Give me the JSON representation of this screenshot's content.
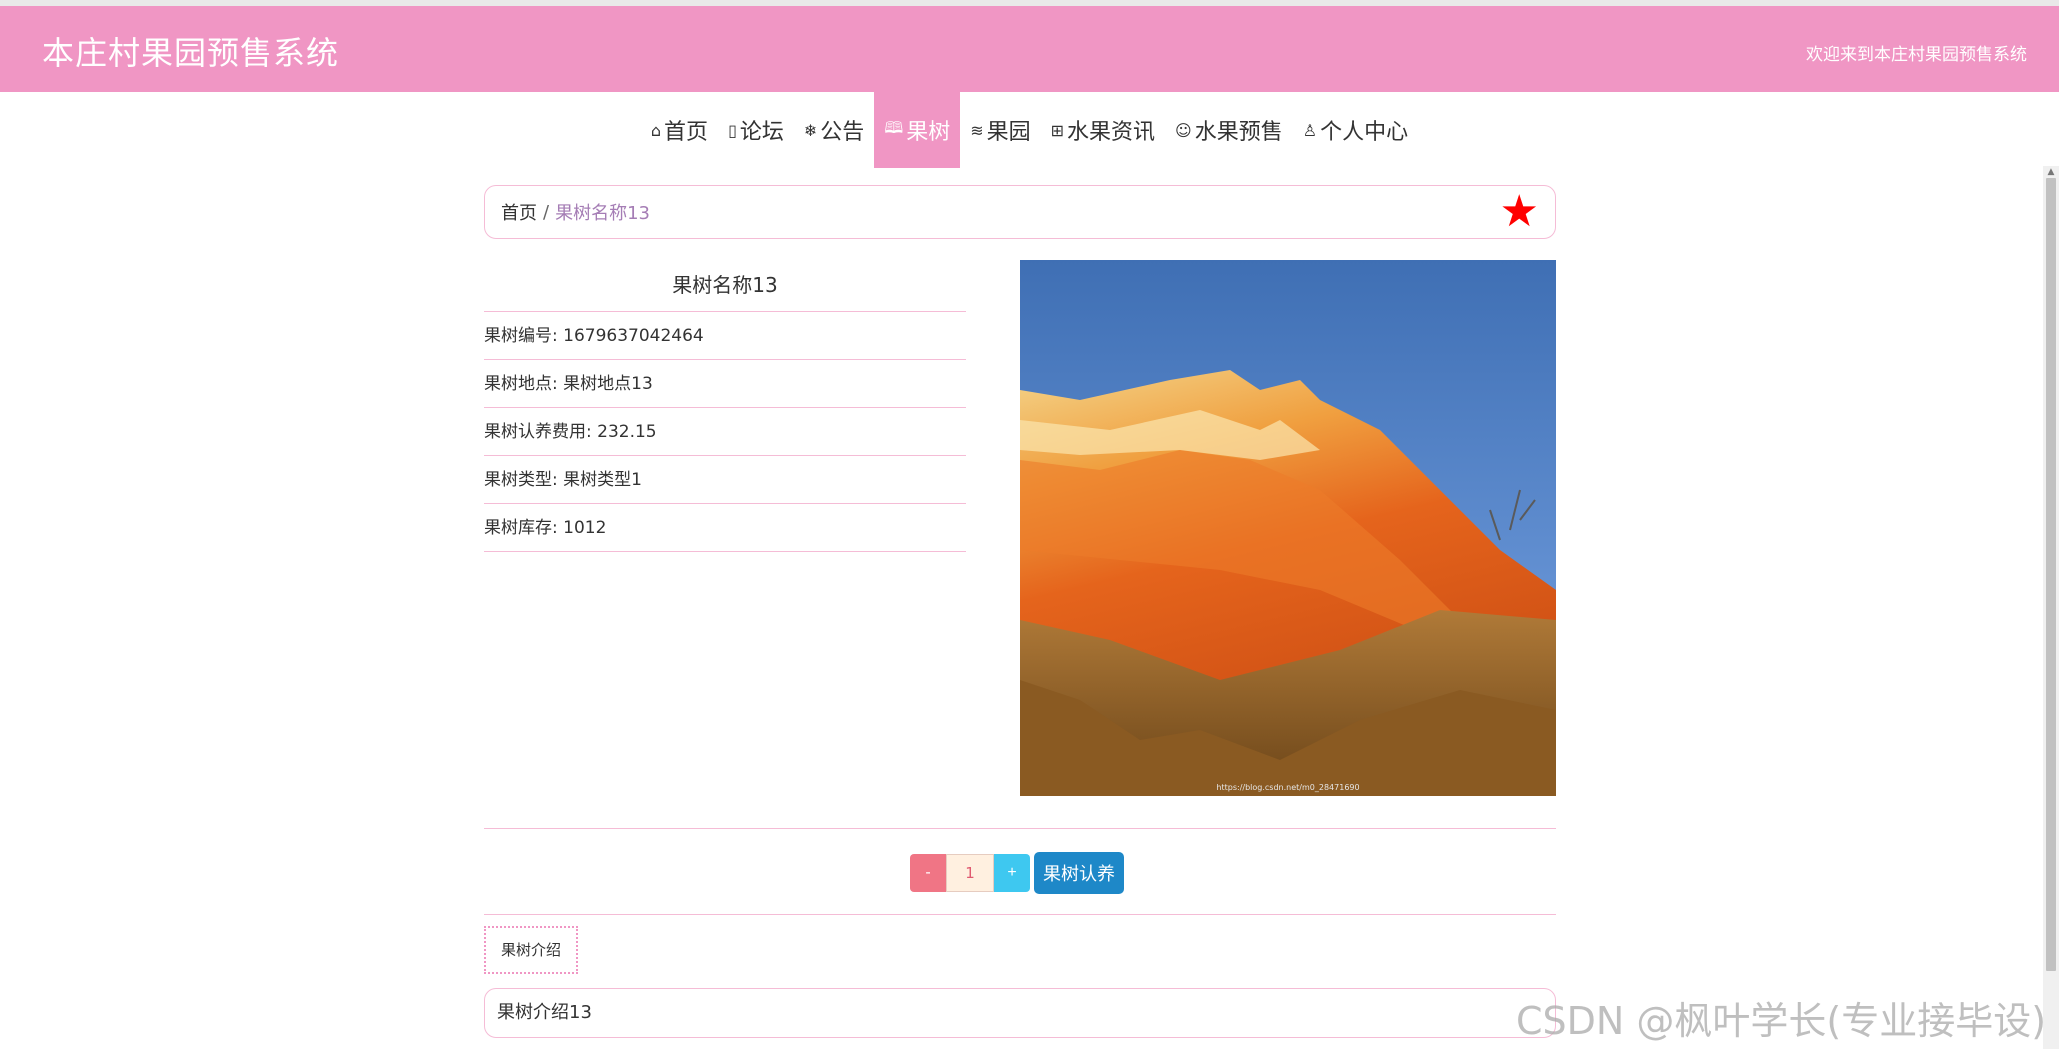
{
  "header": {
    "title": "本庄村果园预售系统",
    "welcome": "欢迎来到本庄村果园预售系统",
    "background_color": "#f096c4"
  },
  "nav": {
    "items": [
      {
        "label": "首页",
        "icon": "home-icon",
        "glyph": "⌂"
      },
      {
        "label": "论坛",
        "icon": "document-icon",
        "glyph": "▯"
      },
      {
        "label": "公告",
        "icon": "snowflake-icon",
        "glyph": "❄"
      },
      {
        "label": "果树",
        "icon": "book-icon",
        "glyph": "🕮"
      },
      {
        "label": "果园",
        "icon": "layers-icon",
        "glyph": "≋"
      },
      {
        "label": "水果资讯",
        "icon": "gift-icon",
        "glyph": "⊞"
      },
      {
        "label": "水果预售",
        "icon": "smile-icon",
        "glyph": "☺"
      },
      {
        "label": "个人中心",
        "icon": "user-icon",
        "glyph": "♙"
      }
    ],
    "active_index": 3
  },
  "breadcrumb": {
    "home": "首页",
    "separator": "/",
    "current": "果树名称13",
    "favorite_icon": "star-icon",
    "favorite_color": "#ff0000"
  },
  "detail": {
    "title": "果树名称13",
    "rows": [
      "果树编号: 1679637042464",
      "果树地点: 果树地点13",
      "果树认养费用: 232.15",
      "果树类型: 果树类型1",
      "果树库存: 1012"
    ],
    "image_caption": "https://blog.csdn.net/m0_28471690"
  },
  "purchase": {
    "minus_label": "-",
    "quantity": "1",
    "plus_label": "+",
    "adopt_label": "果树认养"
  },
  "intro": {
    "tab_label": "果树介绍",
    "content": "果树介绍13"
  },
  "watermark": "CSDN @枫叶学长(专业接毕设)"
}
